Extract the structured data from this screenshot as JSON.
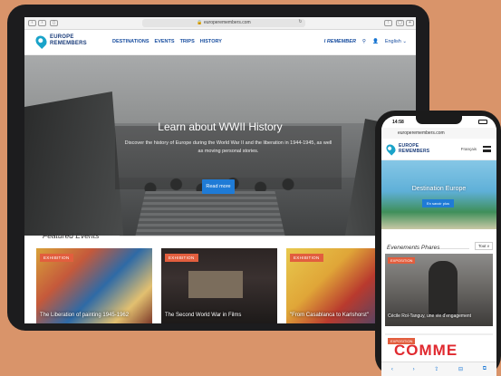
{
  "tablet": {
    "url": "europeremembers.com",
    "logo": {
      "line1": "EUROPE",
      "line2": "REMEMBERS"
    },
    "nav": [
      "DESTINATIONS",
      "EVENTS",
      "TRIPS",
      "HISTORY"
    ],
    "i_remember": "I REMEMBER",
    "language": "English",
    "hero": {
      "title": "Learn about WWII History",
      "subtitle": "Discover the history of Europe during the World War II and the liberation in 1944-1945, as well as moving personal stories.",
      "button": "Read more"
    },
    "featured_heading": "Featured Events",
    "cards": [
      {
        "badge": "EXHIBITION",
        "title": "The Liberation of painting 1945-1962"
      },
      {
        "badge": "EXHIBITION",
        "title": "The Second World War in Films"
      },
      {
        "badge": "EXHIBITION",
        "title": "\"From Casablanca to Karlshorst\""
      }
    ]
  },
  "phone": {
    "time": "14:58",
    "url": "europeremembers.com",
    "logo": {
      "line1": "EUROPE",
      "line2": "REMEMBERS"
    },
    "language": "Français",
    "hero": {
      "title": "Destination Europe",
      "button": "En savoir plus"
    },
    "events_heading": "Evenements Phares",
    "see_all": "Tout v",
    "card": {
      "badge": "EXPOSITION",
      "title": "Cécile Rol-Tanguy, une vie d'engagement"
    },
    "card2": {
      "badge": "EXPOSITION",
      "title": "COMME"
    }
  },
  "colors": {
    "background": "#d9946a",
    "accent": "#1f7bd6",
    "badge": "#e25e3e",
    "brand": "#1a3c7a"
  }
}
